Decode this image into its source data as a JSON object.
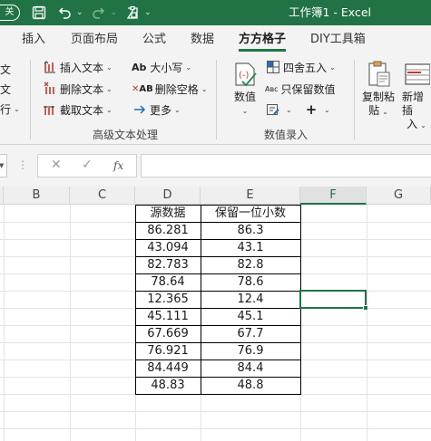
{
  "titlebar": {
    "mode_label": "关",
    "title": "工作簿1  -  Excel"
  },
  "tabs": [
    {
      "label": "插入"
    },
    {
      "label": "页面布局"
    },
    {
      "label": "公式"
    },
    {
      "label": "数据"
    },
    {
      "label": "方方格子",
      "active": true
    },
    {
      "label": "DIY工具箱"
    }
  ],
  "ribbon": {
    "left_fragments": [
      "文",
      "文",
      "行"
    ],
    "text_group": {
      "insert_text": "插入文本",
      "delete_text": "删除文本",
      "cut_text": "截取文本",
      "case": "大小写",
      "delete_space": "删除空格",
      "more": "更多",
      "label": "高级文本处理"
    },
    "numeric_group": {
      "numeric": "数值",
      "round": "四舍五入",
      "keep_number": "只保留数值",
      "label": "数值录入"
    },
    "copy_paste": {
      "line1": "复制粘",
      "line2": "贴"
    },
    "add_new": {
      "line1": "新增插",
      "line2": "入"
    }
  },
  "formula_bar": {
    "cancel": "✕",
    "enter": "✓",
    "fx": "fx",
    "value": ""
  },
  "sheet": {
    "columns": [
      "B",
      "C",
      "D",
      "E",
      "F",
      "G"
    ],
    "selected_column": "F",
    "headers": [
      "源数据",
      "保留一位小数"
    ],
    "rows": [
      [
        "86.281",
        "86.3"
      ],
      [
        "43.094",
        "43.1"
      ],
      [
        "82.783",
        "82.8"
      ],
      [
        "78.64",
        "78.6"
      ],
      [
        "12.365",
        "12.4"
      ],
      [
        "45.111",
        "45.1"
      ],
      [
        "67.669",
        "67.7"
      ],
      [
        "76.921",
        "76.9"
      ],
      [
        "84.449",
        "84.4"
      ],
      [
        "48.83",
        "48.8"
      ]
    ]
  }
}
